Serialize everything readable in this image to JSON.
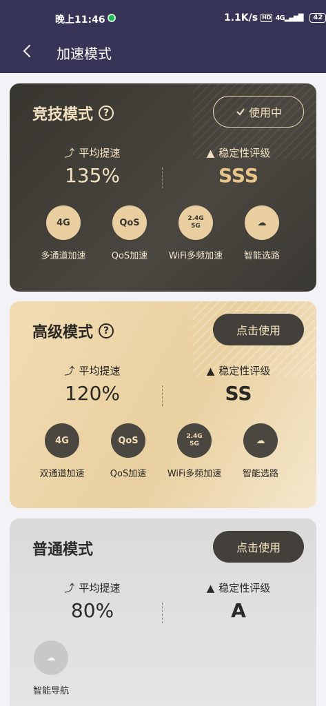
{
  "status_bar": {
    "time": "晚上11:46",
    "network_speed": "1.1K/s",
    "hd": "HD",
    "signal": "4G",
    "battery": "42"
  },
  "header": {
    "title": "加速模式",
    "back_icon": "chevron-left-icon"
  },
  "cards": [
    {
      "name": "竞技模式",
      "button": "使用中",
      "button_icon": "check-icon",
      "avg_speed_label": "平均提速",
      "avg_speed_value": "135%",
      "stability_label": "稳定性评级",
      "stability_value": "SSS",
      "features": [
        {
          "icon": "multi-channel-4g-icon",
          "name": "多通道加速"
        },
        {
          "icon": "qos-icon",
          "name": "QoS加速"
        },
        {
          "icon": "wifi-multiband-icon",
          "name": "WiFi多频加速"
        },
        {
          "icon": "cloud-route-icon",
          "name": "智能选路"
        }
      ]
    },
    {
      "name": "高级模式",
      "button": "点击使用",
      "avg_speed_label": "平均提速",
      "avg_speed_value": "120%",
      "stability_label": "稳定性评级",
      "stability_value": "SS",
      "features": [
        {
          "icon": "dual-channel-4g-icon",
          "name": "双通道加速"
        },
        {
          "icon": "qos-icon",
          "name": "QoS加速"
        },
        {
          "icon": "wifi-multiband-icon",
          "name": "WiFi多频加速"
        },
        {
          "icon": "cloud-route-icon",
          "name": "智能选路"
        }
      ]
    },
    {
      "name": "普通模式",
      "button": "点击使用",
      "avg_speed_label": "平均提速",
      "avg_speed_value": "80%",
      "stability_label": "稳定性评级",
      "stability_value": "A",
      "features": [
        {
          "icon": "cloud-route-icon",
          "name": "智能导航"
        }
      ]
    }
  ],
  "icon_text": {
    "qos": "QoS",
    "g4": "4G",
    "band24": "2.4G",
    "band5": "5G"
  },
  "colors": {
    "header_bg": "#363557",
    "competitive_card_bg": "#37352f",
    "advanced_card_bg": "#ecd6aa",
    "normal_card_bg": "#dedede",
    "gold_accent": "#e8c489"
  }
}
